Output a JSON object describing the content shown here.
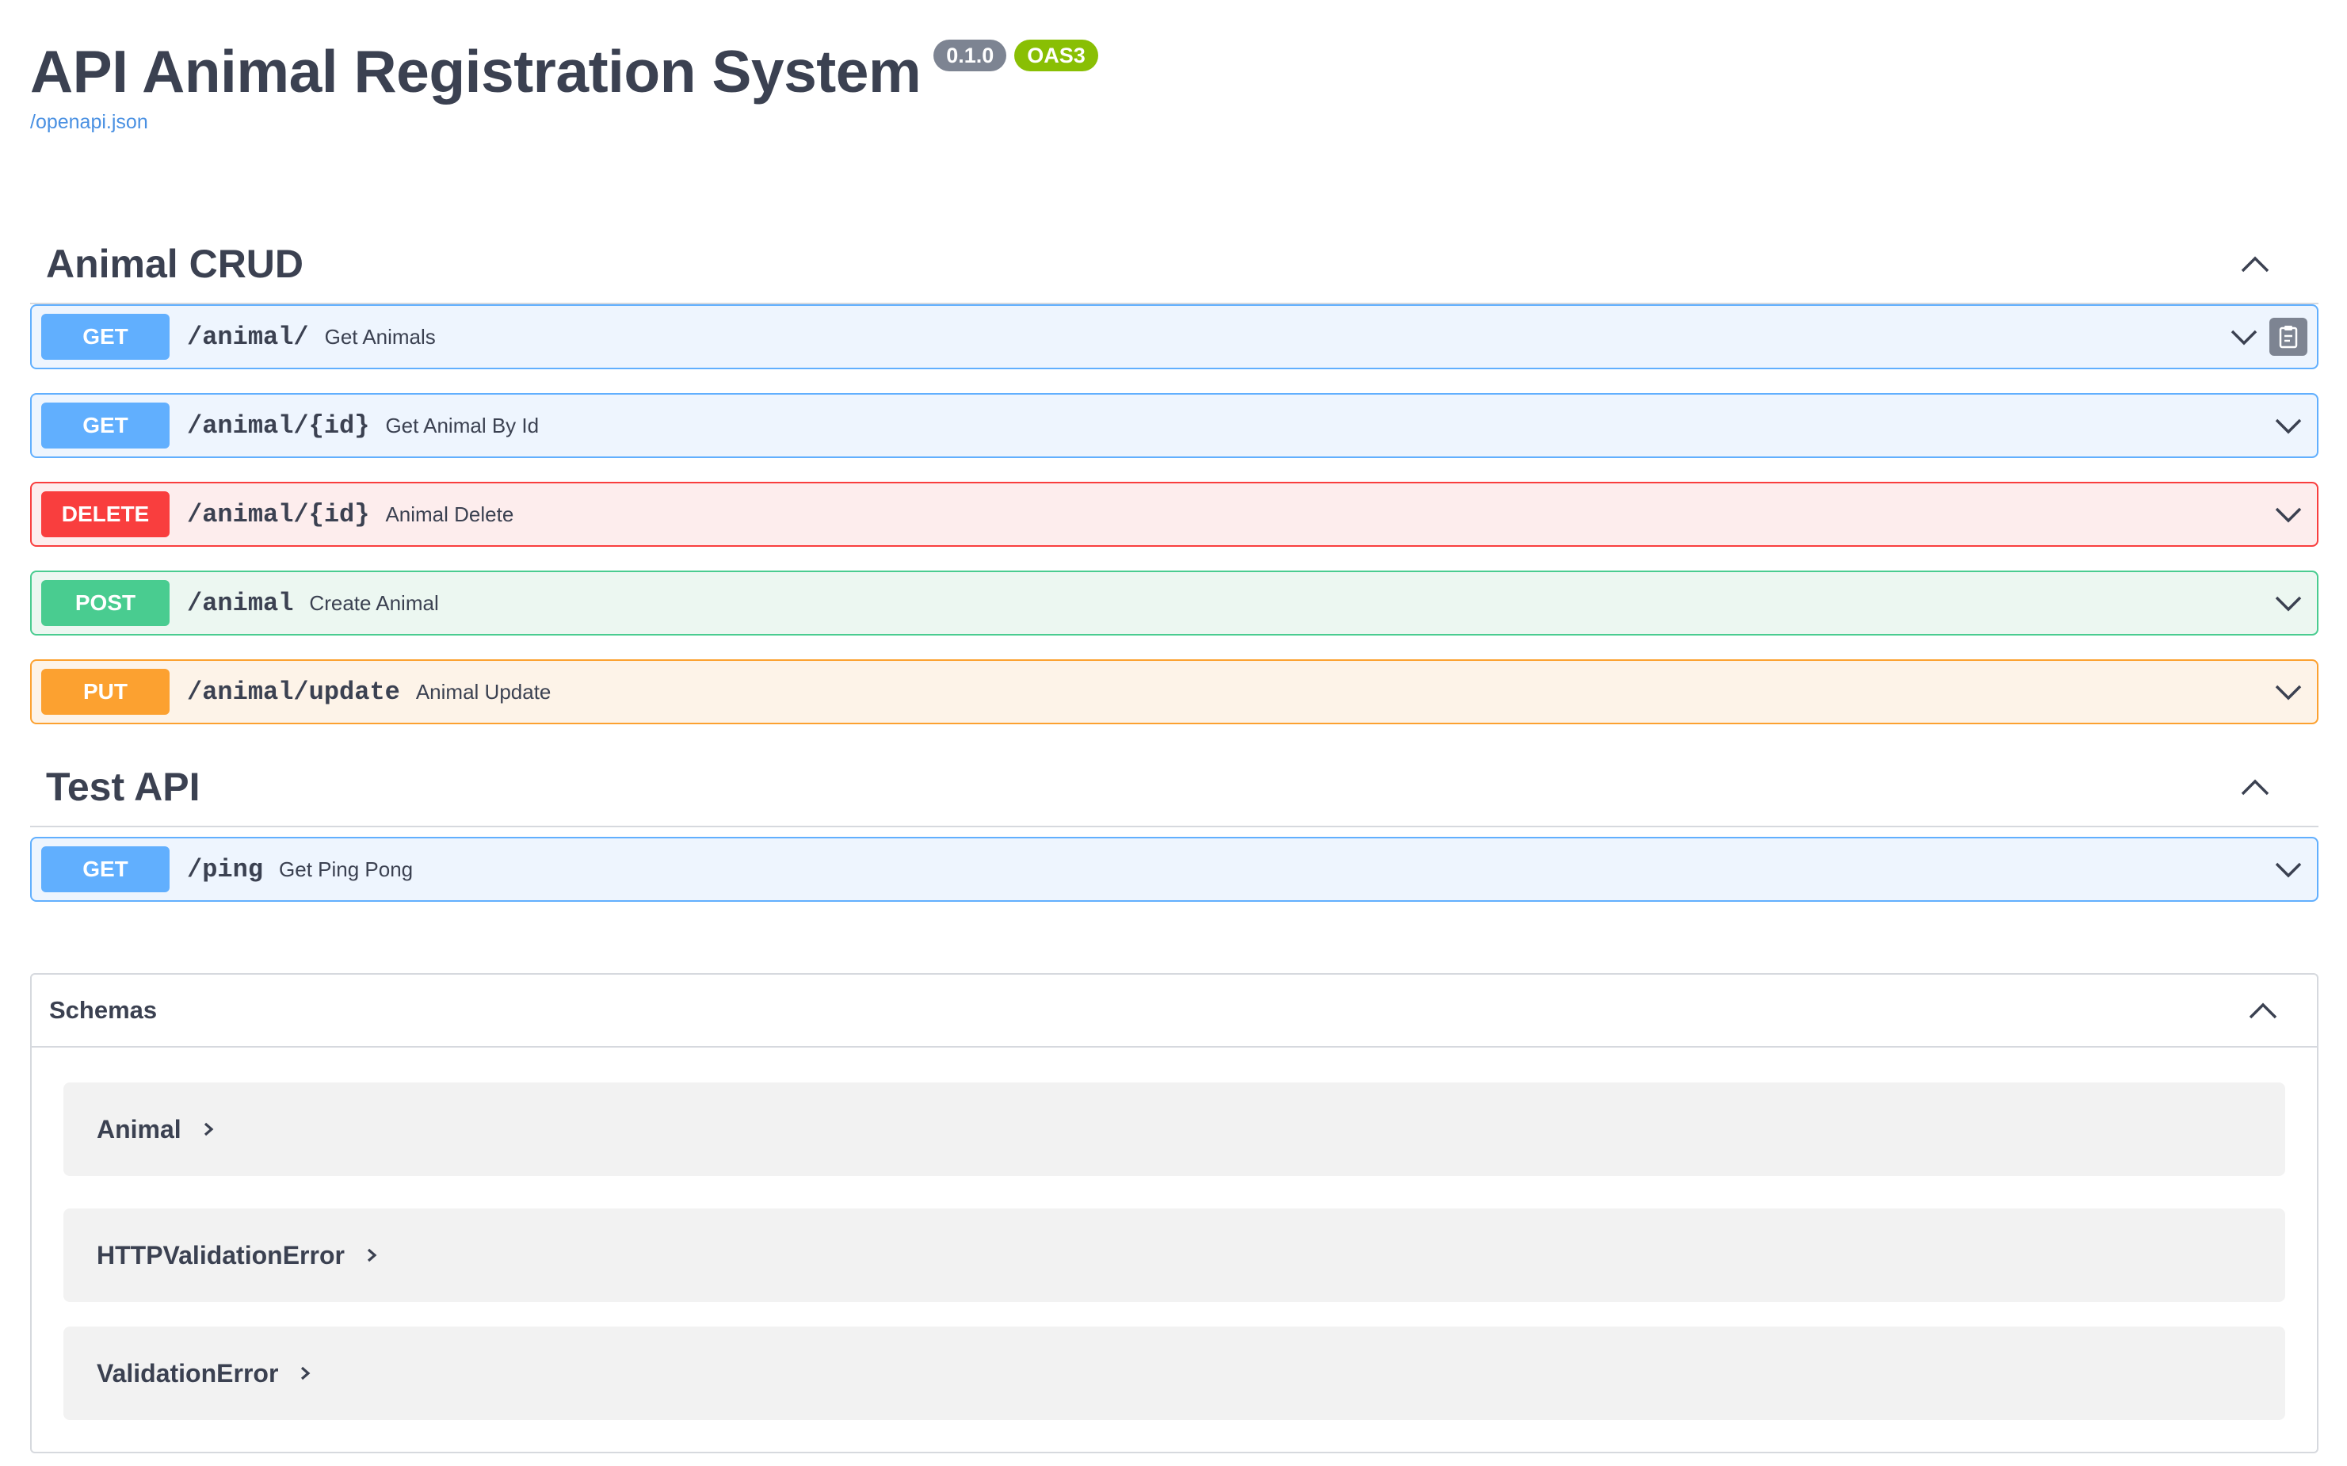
{
  "info": {
    "title": "API Animal Registration System",
    "version": "0.1.0",
    "oas": "OAS3",
    "spec_link": "/openapi.json"
  },
  "tags": [
    {
      "name": "Animal CRUD",
      "operations": [
        {
          "method": "GET",
          "path": "/animal/",
          "summary": "Get Animals"
        },
        {
          "method": "GET",
          "path": "/animal/{id}",
          "summary": "Get Animal By Id"
        },
        {
          "method": "DELETE",
          "path": "/animal/{id}",
          "summary": "Animal Delete"
        },
        {
          "method": "POST",
          "path": "/animal",
          "summary": "Create Animal"
        },
        {
          "method": "PUT",
          "path": "/animal/update",
          "summary": "Animal Update"
        }
      ]
    },
    {
      "name": "Test API",
      "operations": [
        {
          "method": "GET",
          "path": "/ping",
          "summary": "Get Ping Pong"
        }
      ]
    }
  ],
  "schemas": {
    "title": "Schemas",
    "models": [
      {
        "name": "Animal"
      },
      {
        "name": "HTTPValidationError"
      },
      {
        "name": "ValidationError"
      }
    ]
  },
  "colors": {
    "get": "#61affe",
    "delete": "#f93e3e",
    "post": "#49cc90",
    "put": "#fca130",
    "text": "#3b4151",
    "version_badge": "#7d8492",
    "oas_badge": "#89bf04",
    "link": "#4990e2"
  }
}
